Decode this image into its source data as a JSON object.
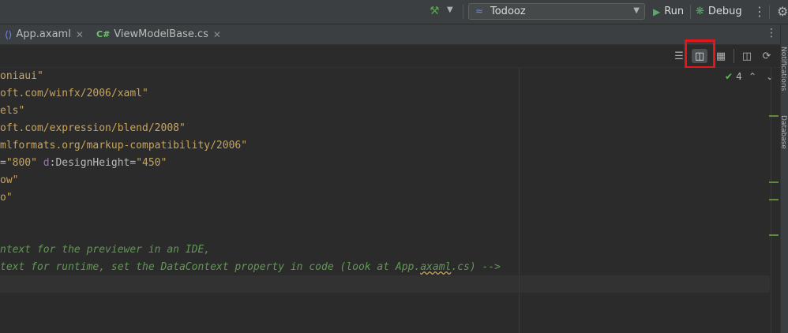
{
  "toolbar": {
    "build_icon": "hammer-icon",
    "run_config": "Todooz",
    "run_label": "Run",
    "debug_label": "Debug"
  },
  "tabs": [
    {
      "label": "App.axaml",
      "icon": "axaml-file-icon"
    },
    {
      "label": "ViewModelBase.cs",
      "icon_text": "C#"
    }
  ],
  "inspections": {
    "count": "4"
  },
  "tool_stripe": {
    "notifications": "Notifications",
    "database": "Database"
  },
  "code": {
    "l1": "oniaui\"",
    "l2": "oft.com/winfx/2006/xaml\"",
    "l3": "els\"",
    "l4": "oft.com/expression/blend/2008\"",
    "l5": "mlformats.org/markup-compatibility/2006\"",
    "l6_a": "=",
    "l6_b": "\"800\"",
    "l6_c": " d",
    "l6_d": ":DesignHeight=",
    "l6_e": "\"450\"",
    "l7": "ow\"",
    "l8": "o\"",
    "l9": "ntext for the previewer in an IDE,",
    "l10_a": "text for runtime, set the DataContext property in code (look at App.",
    "l10_b": "axaml",
    "l10_c": ".cs) -->"
  },
  "colors": {
    "accent_red": "#e3171b",
    "run_green": "#59a869"
  }
}
